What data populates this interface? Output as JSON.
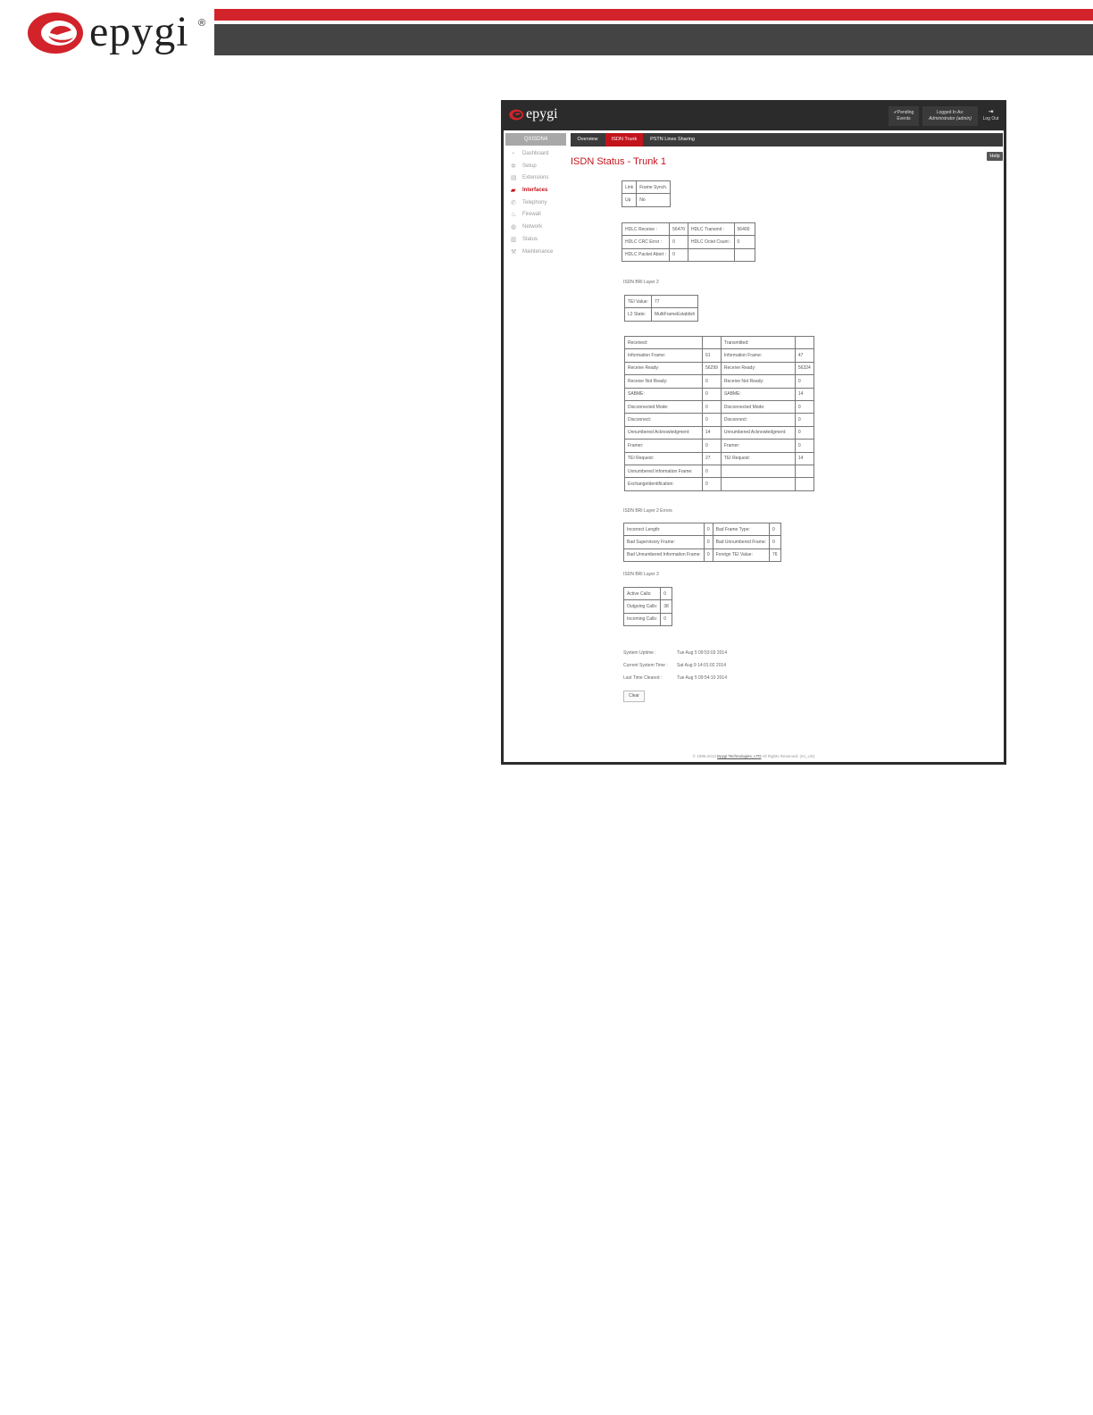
{
  "document": {
    "brand": "epygi",
    "reg_mark": "®"
  },
  "app": {
    "brand": "epygi",
    "pending": {
      "line1": "✔Pending",
      "line2": "Events"
    },
    "logged": {
      "line1": "Logged In As:",
      "line2": "Administrator (admin)"
    },
    "logout": {
      "icon": "⇥",
      "label": "Log Out"
    },
    "device": "QXISDN4",
    "nav": [
      {
        "label": "Dashboard",
        "icon": "◔"
      },
      {
        "label": "Setup",
        "icon": "✲"
      },
      {
        "label": "Extensions",
        "icon": "▤"
      },
      {
        "label": "Interfaces",
        "icon": "▰"
      },
      {
        "label": "Telephony",
        "icon": "✆"
      },
      {
        "label": "Firewall",
        "icon": "♨"
      },
      {
        "label": "Network",
        "icon": "◍"
      },
      {
        "label": "Status",
        "icon": "▥"
      },
      {
        "label": "Maintenance",
        "icon": "⚒"
      }
    ],
    "tabs": [
      "Overview",
      "ISDN Trunk",
      "PSTN Lines Sharing"
    ],
    "title": "ISDN Status - Trunk 1",
    "help": "Help",
    "link_table": [
      [
        "Link",
        "Frame Synch."
      ],
      [
        "Up",
        "No"
      ]
    ],
    "hdlc_table": [
      [
        "HDLC Receive :",
        "56470",
        "HDLC Transmit :",
        "56400"
      ],
      [
        "HDLC CRC Error :",
        "0",
        "HDLC Octet Count :",
        "0"
      ],
      [
        "HDLC Packet Abort :",
        "0",
        "",
        ""
      ]
    ],
    "layer2_label": "ISDN BRI Layer 2",
    "tei_table": [
      [
        "TEI Value:",
        "77"
      ],
      [
        "L2 State:",
        "MultiFrameEstablish"
      ]
    ],
    "frames_table": [
      [
        "Received:",
        "",
        "Transmitted:",
        ""
      ],
      [
        "Information Frame:",
        "61",
        "Information Frame:",
        "47"
      ],
      [
        "Receive Ready:",
        "56299",
        "Receive Ready:",
        "56324"
      ],
      [
        "Receive Not Ready:",
        "0",
        "Receive Not Ready:",
        "0"
      ],
      [
        "SABME:",
        "0",
        "SABME:",
        "14"
      ],
      [
        "Disconnected Mode:",
        "0",
        "Disconnected Mode:",
        "0"
      ],
      [
        "Disconnect:",
        "0",
        "Disconnect:",
        "0"
      ],
      [
        "Unnumbered Acknowledgment:",
        "14",
        "Unnumbered Acknowledgment:",
        "0"
      ],
      [
        "Framer:",
        "0",
        "Framer:",
        "0"
      ],
      [
        "TEI Request:",
        "27",
        "TEI Request:",
        "14"
      ],
      [
        "Unnumbered Information Frame:",
        "0",
        "",
        ""
      ],
      [
        "ExchangeIdentification:",
        "0",
        "",
        ""
      ]
    ],
    "layer2_errors_label": "ISDN BRI Layer 2 Errors",
    "errors_table": [
      [
        "Incorrect Length:",
        "0",
        "Bad Frame Type:",
        "0"
      ],
      [
        "Bad Supervisory Frame:",
        "0",
        "Bad Unnumbered Frame:",
        "0"
      ],
      [
        "Bad Unnumbered Information Frame:",
        "0",
        "Foreign TEI Value:",
        "76"
      ]
    ],
    "layer3_label": "ISDN BRI Layer 3",
    "calls_table": [
      [
        "Active Calls:",
        "0"
      ],
      [
        "Outgoing Calls:",
        "38"
      ],
      [
        "Incoming Calls:",
        "0"
      ]
    ],
    "times": [
      {
        "label": "System Uptime :",
        "value": "Tue Aug 5 09:53:03 2014"
      },
      {
        "label": "Current System Time :",
        "value": "Sat Aug 9 14:01:02 2014"
      },
      {
        "label": "Last Time Cleared :",
        "value": "Tue Aug 5 09:54:10 2014"
      }
    ],
    "clear": "Clear",
    "footer": {
      "pre": "© 1996-2014 ",
      "link": "Epygi Technologies, LTD",
      "post": " All Rights Reserved. (en_US)"
    }
  },
  "colors": {
    "brand_red": "#c2141c",
    "header_dark": "#2b2b2b",
    "doc_red": "#d2232a"
  }
}
